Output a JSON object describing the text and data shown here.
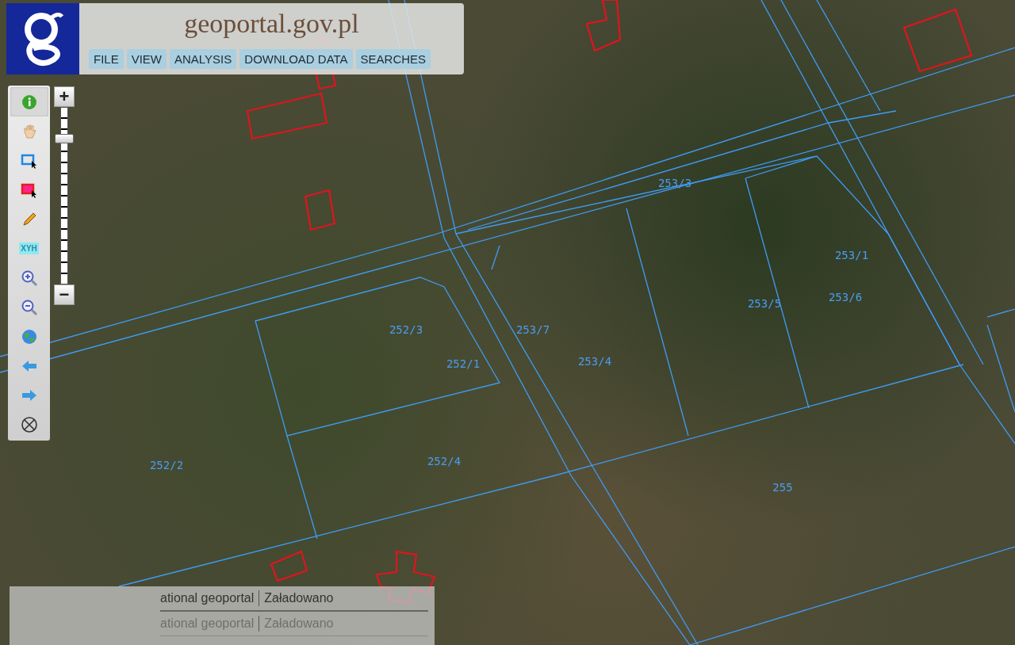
{
  "header": {
    "logo_text": "geoportal.gov.pl",
    "menu": [
      {
        "label": "FILE"
      },
      {
        "label": "VIEW"
      },
      {
        "label": "ANALYSIS"
      },
      {
        "label": "DOWNLOAD DATA"
      },
      {
        "label": "SEARCHES"
      }
    ]
  },
  "toolbar": {
    "tools": [
      {
        "kind": "info",
        "selected": true
      },
      {
        "kind": "pan",
        "selected": false
      },
      {
        "kind": "select",
        "selected": false
      },
      {
        "kind": "select-red",
        "selected": false
      },
      {
        "kind": "pencil",
        "selected": false
      },
      {
        "kind": "xyh",
        "label": "XYH",
        "selected": false
      },
      {
        "kind": "zoom-in",
        "selected": false
      },
      {
        "kind": "zoom-out",
        "selected": false
      },
      {
        "kind": "globe",
        "selected": false
      },
      {
        "kind": "back",
        "selected": false
      },
      {
        "kind": "forward",
        "selected": false
      },
      {
        "kind": "extent",
        "selected": false
      }
    ]
  },
  "zoom": {
    "plus": "+",
    "minus": "−",
    "level": 0.84
  },
  "map": {
    "parcels": [
      "253/3",
      "253/1",
      "253/5",
      "253/6",
      "252/3",
      "253/7",
      "252/1",
      "253/4",
      "252/2",
      "252/4",
      "255"
    ]
  },
  "status": {
    "rows": [
      {
        "source": "ational geoportal",
        "state": "Załadowano",
        "disabled": false
      },
      {
        "source": "ational geoportal",
        "state": "Załadowano",
        "disabled": true
      }
    ]
  }
}
